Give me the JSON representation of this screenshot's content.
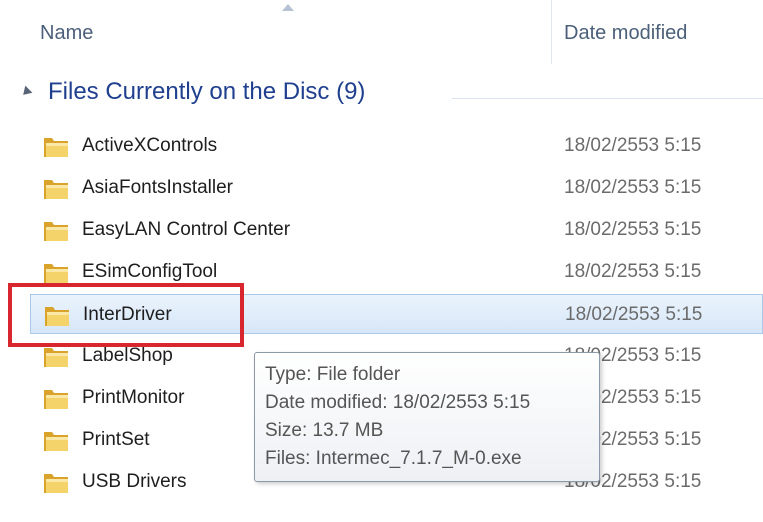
{
  "header": {
    "name_label": "Name",
    "date_label": "Date modified"
  },
  "group": {
    "title": "Files Currently on the Disc (9)"
  },
  "rows": [
    {
      "name": "ActiveXControls",
      "date": "18/02/2553 5:15"
    },
    {
      "name": "AsiaFontsInstaller",
      "date": "18/02/2553 5:15"
    },
    {
      "name": "EasyLAN Control Center",
      "date": "18/02/2553 5:15"
    },
    {
      "name": "ESimConfigTool",
      "date": "18/02/2553 5:15"
    },
    {
      "name": "InterDriver",
      "date": "18/02/2553 5:15",
      "selected": true
    },
    {
      "name": "LabelShop",
      "date": "18/02/2553 5:15"
    },
    {
      "name": "PrintMonitor",
      "date": "18/02/2553 5:15"
    },
    {
      "name": "PrintSet",
      "date": "18/02/2553 5:15"
    },
    {
      "name": "USB Drivers",
      "date": "18/02/2553 5:15"
    }
  ],
  "tooltip": {
    "type": "Type: File folder",
    "date": "Date modified: 18/02/2553 5:15",
    "size": "Size: 13.7 MB",
    "files": "Files: Intermec_7.1.7_M-0.exe"
  },
  "icons": {
    "folder": "folder-icon",
    "sort": "sort-ascending-icon",
    "collapse": "collapse-group-icon"
  },
  "colors": {
    "accent": "#1f3f8f",
    "highlight_box": "#d7262e",
    "selection": "#d7e7f8"
  }
}
